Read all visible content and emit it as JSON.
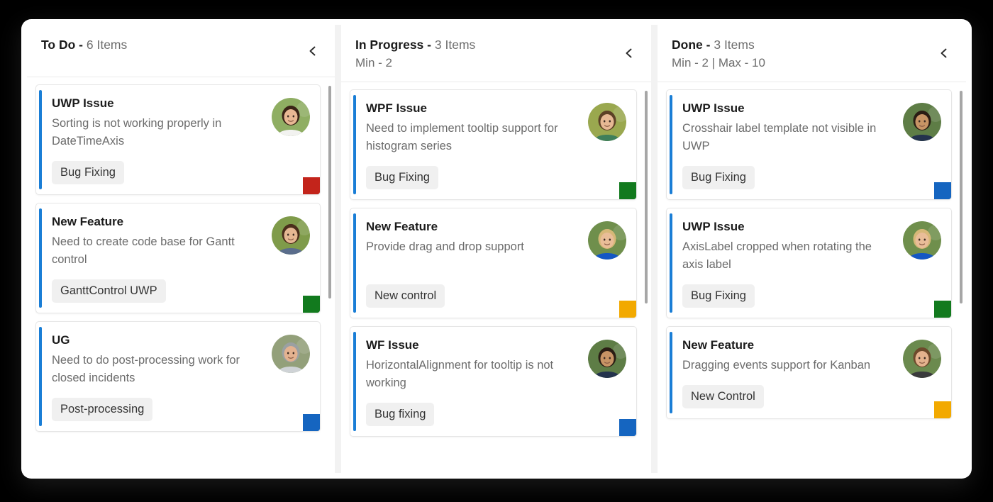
{
  "board": {
    "columns": [
      {
        "name": "To Do",
        "separator": "-",
        "count": "6",
        "items_word": "Items",
        "constraint": "",
        "collapse_icon": "chevron-left-icon",
        "cards": [
          {
            "title": "UWP Issue",
            "description": "Sorting is not working properly in DateTimeAxis",
            "tag": "Bug Fixing",
            "accent_color": "#1a7ed6",
            "corner_color": "#c3241b",
            "avatar": "avatar-woman-brunette"
          },
          {
            "title": "New Feature",
            "description": "Need to create code base for Gantt control",
            "tag": "GanttControl UWP",
            "accent_color": "#1a7ed6",
            "corner_color": "#127a1e",
            "avatar": "avatar-woman-long-hair"
          },
          {
            "title": "UG",
            "description": "Need to do post-processing work for closed incidents",
            "tag": "Post-processing",
            "accent_color": "#1a7ed6",
            "corner_color": "#1565c0",
            "avatar": "avatar-woman-gray-hair"
          }
        ]
      },
      {
        "name": "In Progress",
        "separator": "-",
        "count": "3",
        "items_word": "Items",
        "constraint": "Min - 2",
        "collapse_icon": "chevron-left-icon",
        "cards": [
          {
            "title": "WPF Issue",
            "description": "Need to implement tooltip support for histogram series",
            "tag": "Bug Fixing",
            "accent_color": "#1a7ed6",
            "corner_color": "#127a1e",
            "avatar": "avatar-woman-scarf"
          },
          {
            "title": "New Feature",
            "description": "Provide drag and drop support",
            "tag": "New control",
            "accent_color": "#1a7ed6",
            "corner_color": "#f2a900",
            "avatar": "avatar-woman-blonde"
          },
          {
            "title": "WF Issue",
            "description": "HorizontalAlignment for tooltip is not working",
            "tag": "Bug fixing",
            "accent_color": "#1a7ed6",
            "corner_color": "#1565c0",
            "avatar": "avatar-man-suit"
          }
        ]
      },
      {
        "name": "Done",
        "separator": "-",
        "count": "3",
        "items_word": "Items",
        "constraint": "Min - 2 | Max - 10",
        "collapse_icon": "chevron-left-icon",
        "cards": [
          {
            "title": "UWP Issue",
            "description": "Crosshair label template not visible in UWP",
            "tag": "Bug Fixing",
            "accent_color": "#1a7ed6",
            "corner_color": "#1565c0",
            "avatar": "avatar-man-suit"
          },
          {
            "title": "UWP Issue",
            "description": "AxisLabel cropped when rotating the axis label",
            "tag": "Bug Fixing",
            "accent_color": "#1a7ed6",
            "corner_color": "#127a1e",
            "avatar": "avatar-woman-blonde"
          },
          {
            "title": "New Feature",
            "description": "Dragging events support for Kanban",
            "tag": "New Control",
            "accent_color": "#1a7ed6",
            "corner_color": "#f2a900",
            "avatar": "avatar-woman-ponytail"
          }
        ]
      }
    ]
  },
  "theme": {
    "page_background": "#000000",
    "panel_background": "#ffffff",
    "board_gap_color": "#f2f2f2",
    "accent_blue": "#1a7ed6",
    "tag_background": "#f0f0f0",
    "title_color": "#1b1b1b",
    "muted_text": "#6b6b6b",
    "scrollbar_color": "#a6a6a6"
  }
}
